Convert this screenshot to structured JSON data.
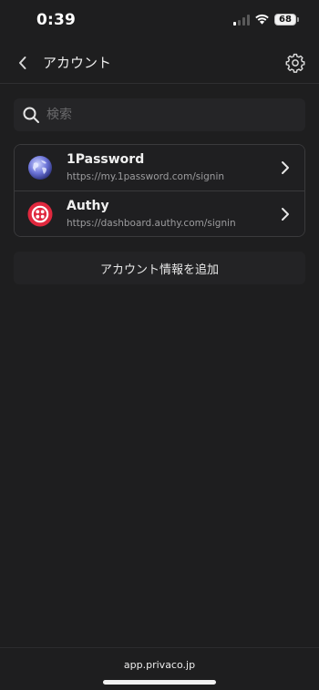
{
  "status_bar": {
    "time": "0:39",
    "battery": "68",
    "icons": [
      "cellular-signal-icon",
      "wifi-icon",
      "battery-icon"
    ]
  },
  "nav": {
    "title": "アカウント",
    "back_icon": "chevron-left-icon",
    "settings_icon": "gear-icon"
  },
  "search": {
    "placeholder": "検索",
    "value": ""
  },
  "accounts": [
    {
      "name": "1Password",
      "url": "https://my.1password.com/signin",
      "icon": "globe-icon"
    },
    {
      "name": "Authy",
      "url": "https://dashboard.authy.com/signin",
      "icon": "authy-logo-icon"
    }
  ],
  "add_account_label": "アカウント情報を追加",
  "footer": {
    "domain": "app.privaco.jp"
  },
  "colors": {
    "background": "#1e1e1f",
    "text": "#ececec",
    "muted": "#9c9c9e",
    "authy_red": "#e0283e"
  }
}
